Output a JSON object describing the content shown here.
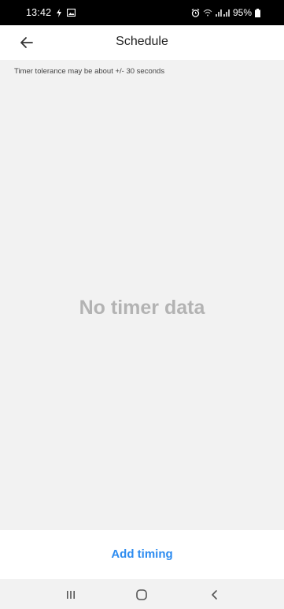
{
  "status_bar": {
    "time": "13:42",
    "battery": "95%",
    "icons": [
      "bolt-icon",
      "gallery-icon",
      "alarm-icon",
      "wifi-icon",
      "signal-icon",
      "battery-icon"
    ]
  },
  "header": {
    "title": "Schedule",
    "back_icon": "arrow-left-icon"
  },
  "main": {
    "tolerance_note": "Timer tolerance may be about +/- 30 seconds",
    "empty_message": "No timer data"
  },
  "actions": {
    "add_timing_label": "Add timing",
    "accent_color": "#2d8cf0"
  },
  "nav": {
    "icons": [
      "recent-apps-icon",
      "home-icon",
      "back-icon"
    ]
  }
}
